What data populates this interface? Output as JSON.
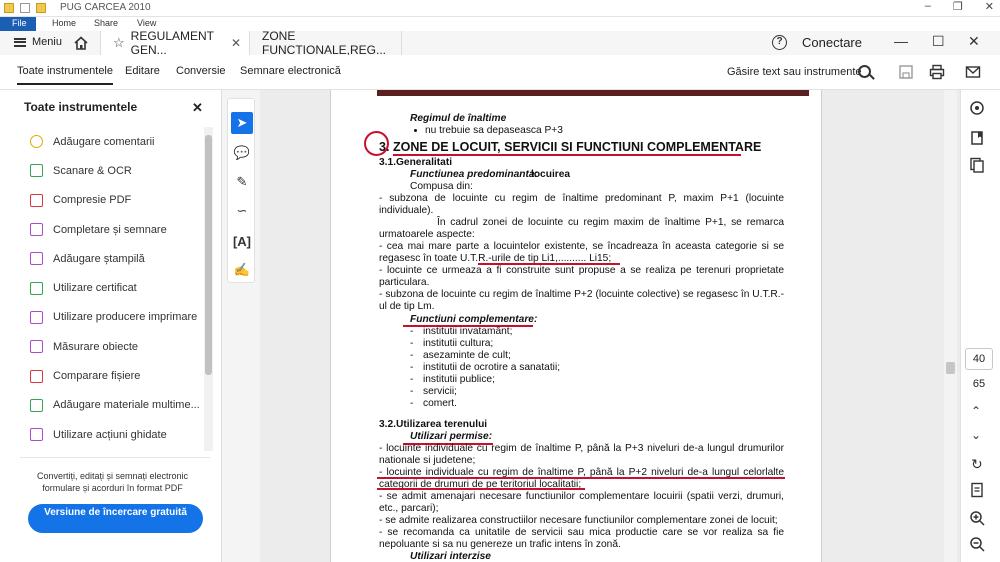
{
  "explorer": {
    "title": "PUG CARCEA 2010",
    "tabs": [
      "File",
      "Home",
      "Share",
      "View"
    ]
  },
  "titlebar": {
    "menu_label": "Meniu",
    "tabs": [
      {
        "label": "REGULAMENT GEN...",
        "active": true
      },
      {
        "label": "ZONE FUNCTIONALE,REG...",
        "active": false
      }
    ],
    "connect_label": "Conectare"
  },
  "toolbar": {
    "items": [
      "Toate instrumentele",
      "Editare",
      "Conversie",
      "Semnare electronică"
    ],
    "find_label": "Găsire text sau instrumente"
  },
  "left_panel": {
    "title": "Toate instrumentele",
    "items": [
      {
        "label": "Adăugare comentarii",
        "color": "#e8a600"
      },
      {
        "label": "Scanare & OCR",
        "color": "#2fa84f"
      },
      {
        "label": "Compresie PDF",
        "color": "#d9363e"
      },
      {
        "label": "Completare și semnare",
        "color": "#a84bd1"
      },
      {
        "label": "Adăugare ștampilă",
        "color": "#a84bd1"
      },
      {
        "label": "Utilizare certificat",
        "color": "#2fa84f"
      },
      {
        "label": "Utilizare producere imprimare",
        "color": "#a84bd1"
      },
      {
        "label": "Măsurare obiecte",
        "color": "#a84bd1"
      },
      {
        "label": "Comparare fișiere",
        "color": "#d9363e"
      },
      {
        "label": "Adăugare materiale multime...",
        "color": "#2fa84f"
      },
      {
        "label": "Utilizare acțiuni ghidate",
        "color": "#a84bd1"
      }
    ],
    "promo_text": "Convertiți, editați și semnați electronic formulare și acorduri în format PDF",
    "trial_button": "Versiune de încercare gratuită"
  },
  "document": {
    "line1": "Regimul de înaltime",
    "line2": "nu trebuie sa depaseasca P+3",
    "heading_num": "3.",
    "heading": "ZONE DE LOCUIT, SERVICII SI FUNCTIUNI COMPLEMENTARE",
    "sec31": "3.1.Generalitati",
    "func_pre_label": "Functiunea predominanta:",
    "func_pre_val": "locuirea",
    "compusa": "Compusa din:",
    "p1": "- subzona de locuinte cu regim de înaltime predominant P, maxim P+1 (locuinte individuale).",
    "p2": "În cadrul zonei de locuinte cu regim maxim de înaltime P+1, se remarca urmatoarele aspecte:",
    "p3": "- cea mai mare parte a locuintelor existente, se încadreaza în aceasta categorie si se regasesc în toate U.T.R.-urile de tip Li1,.......... Li15;",
    "p4": "- locuinte ce urmeaza a fi construite sunt propuse a se realiza pe terenuri proprietate particulara.",
    "p5": "- subzona de locuinte cu regim de înaltime P+2 (locuinte colective) se regasesc în U.T.R.-ul de tip Lm.",
    "func_comp": "Functiuni complementare:",
    "comp_items": [
      "institutii invatamânt;",
      "institutii cultura;",
      "asezaminte de cult;",
      "institutii de ocrotire a sanatatii;",
      "institutii publice;",
      "servicii;",
      "comert."
    ],
    "sec32": "3.2.Utilizarea terenului",
    "util_perm": "Utilizari permise:",
    "q1": "- locuinte individuale cu regim de înaltime P, până la P+3 niveluri de-a lungul drumurilor nationale si judetene;",
    "q2": "- locuinte individuale cu regim de înaltime P, până la P+2 niveluri de-a lungul celorlalte categorii de drumuri de pe teritoriul localitatii;",
    "q3": "- se admit amenajari necesare functiunilor complementare locuirii (spatii verzi, drumuri, etc., parcari);",
    "q4": "- se admite realizarea constructiilor necesare functiunilor complementare zonei de locuit;",
    "q5": "- se recomanda ca unitatile de servicii sau mica productie care se vor realiza sa fie nepoluante si sa nu genereze un trafic intens în zonă.",
    "util_interz": "Utilizari interzise"
  },
  "right_rail": {
    "page_current": "40",
    "page_total": "65"
  }
}
